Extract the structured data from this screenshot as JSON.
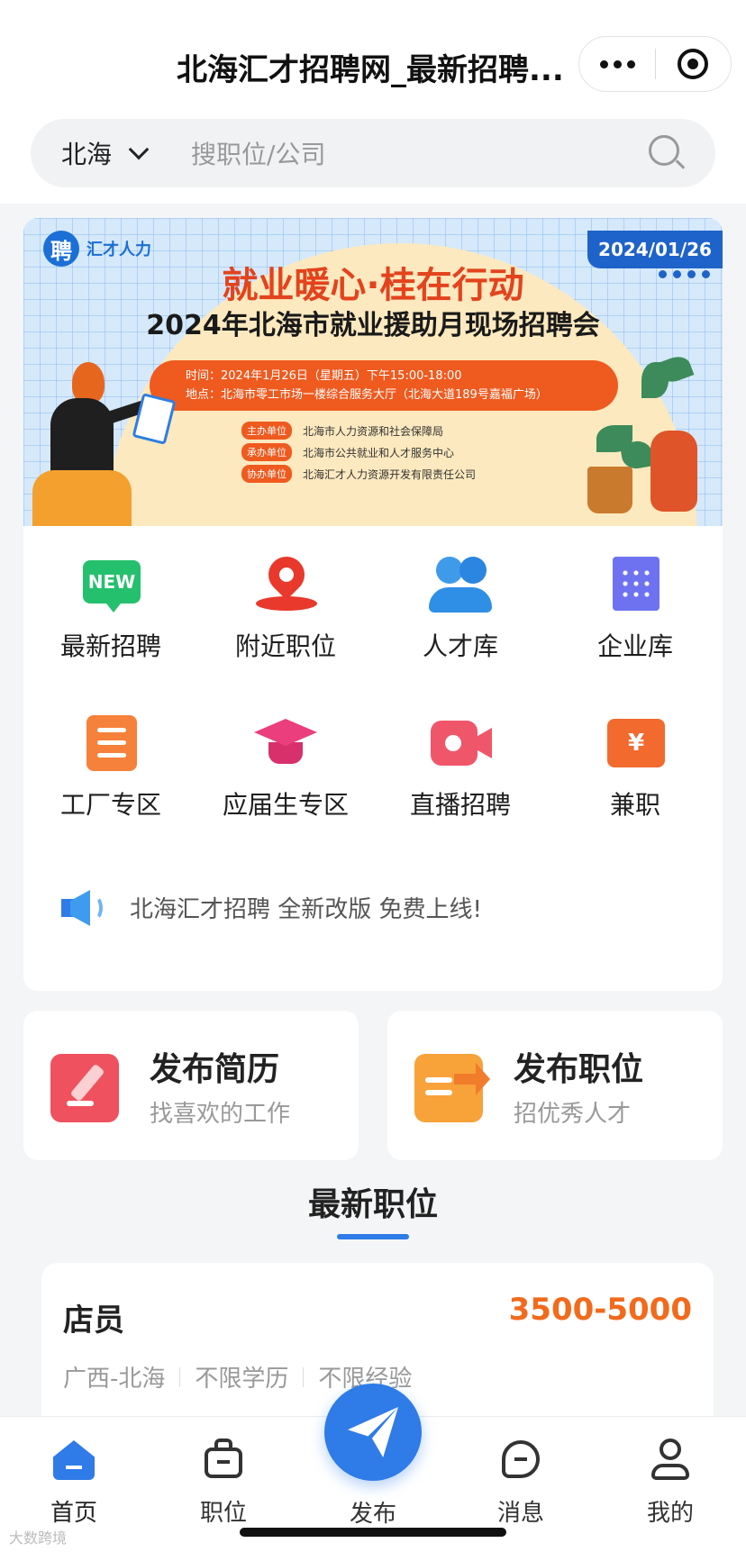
{
  "header": {
    "title": "北海汇才招聘网_最新招聘...",
    "city": "北海",
    "search_placeholder": "搜职位/公司"
  },
  "banner": {
    "brand": "汇才人力",
    "brand_badge": "聘",
    "date": "2024/01/26",
    "headline": "就业暖心·桂在行动",
    "subhead": "2024年北海市就业援助月现场招聘会",
    "time_line": "时间：2024年1月26日（星期五）下午15:00-18:00",
    "place_line": "地点：北海市零工市场一楼综合服务大厅（北海大道189号嘉福广场）",
    "organizers": [
      {
        "role": "主办单位",
        "name": "北海市人力资源和社会保障局"
      },
      {
        "role": "承办单位",
        "name": "北海市公共就业和人才服务中心"
      },
      {
        "role": "协办单位",
        "name": "北海汇才人力资源开发有限责任公司"
      }
    ]
  },
  "menu": [
    {
      "label": "最新招聘",
      "icon": "new-icon",
      "badge": "NEW"
    },
    {
      "label": "附近职位",
      "icon": "location-pin-icon"
    },
    {
      "label": "人才库",
      "icon": "people-icon"
    },
    {
      "label": "企业库",
      "icon": "building-icon"
    },
    {
      "label": "工厂专区",
      "icon": "list-icon"
    },
    {
      "label": "应届生专区",
      "icon": "graduation-cap-icon"
    },
    {
      "label": "直播招聘",
      "icon": "video-camera-icon"
    },
    {
      "label": "兼职",
      "icon": "yen-ticket-icon",
      "badge": "¥"
    }
  ],
  "notice": {
    "text": "北海汇才招聘 全新改版 免费上线!"
  },
  "actions": [
    {
      "title": "发布简历",
      "subtitle": "找喜欢的工作"
    },
    {
      "title": "发布职位",
      "subtitle": "招优秀人才"
    }
  ],
  "section": {
    "title": "最新职位"
  },
  "jobs": [
    {
      "title": "店员",
      "salary": "3500-5000",
      "tags": [
        "广西-北海",
        "不限学历",
        "不限经验"
      ]
    }
  ],
  "tabbar": {
    "items": [
      {
        "label": "首页",
        "icon": "home-icon",
        "active": true
      },
      {
        "label": "职位",
        "icon": "briefcase-icon",
        "active": false
      },
      {
        "label": "发布",
        "icon": "paper-plane-icon",
        "active": false
      },
      {
        "label": "消息",
        "icon": "message-icon",
        "active": false
      },
      {
        "label": "我的",
        "icon": "user-icon",
        "active": false
      }
    ]
  },
  "colors": {
    "accent": "#2f7be7",
    "salary": "#f26a1b",
    "headline": "#e3431d"
  },
  "watermark": "大数跨境"
}
